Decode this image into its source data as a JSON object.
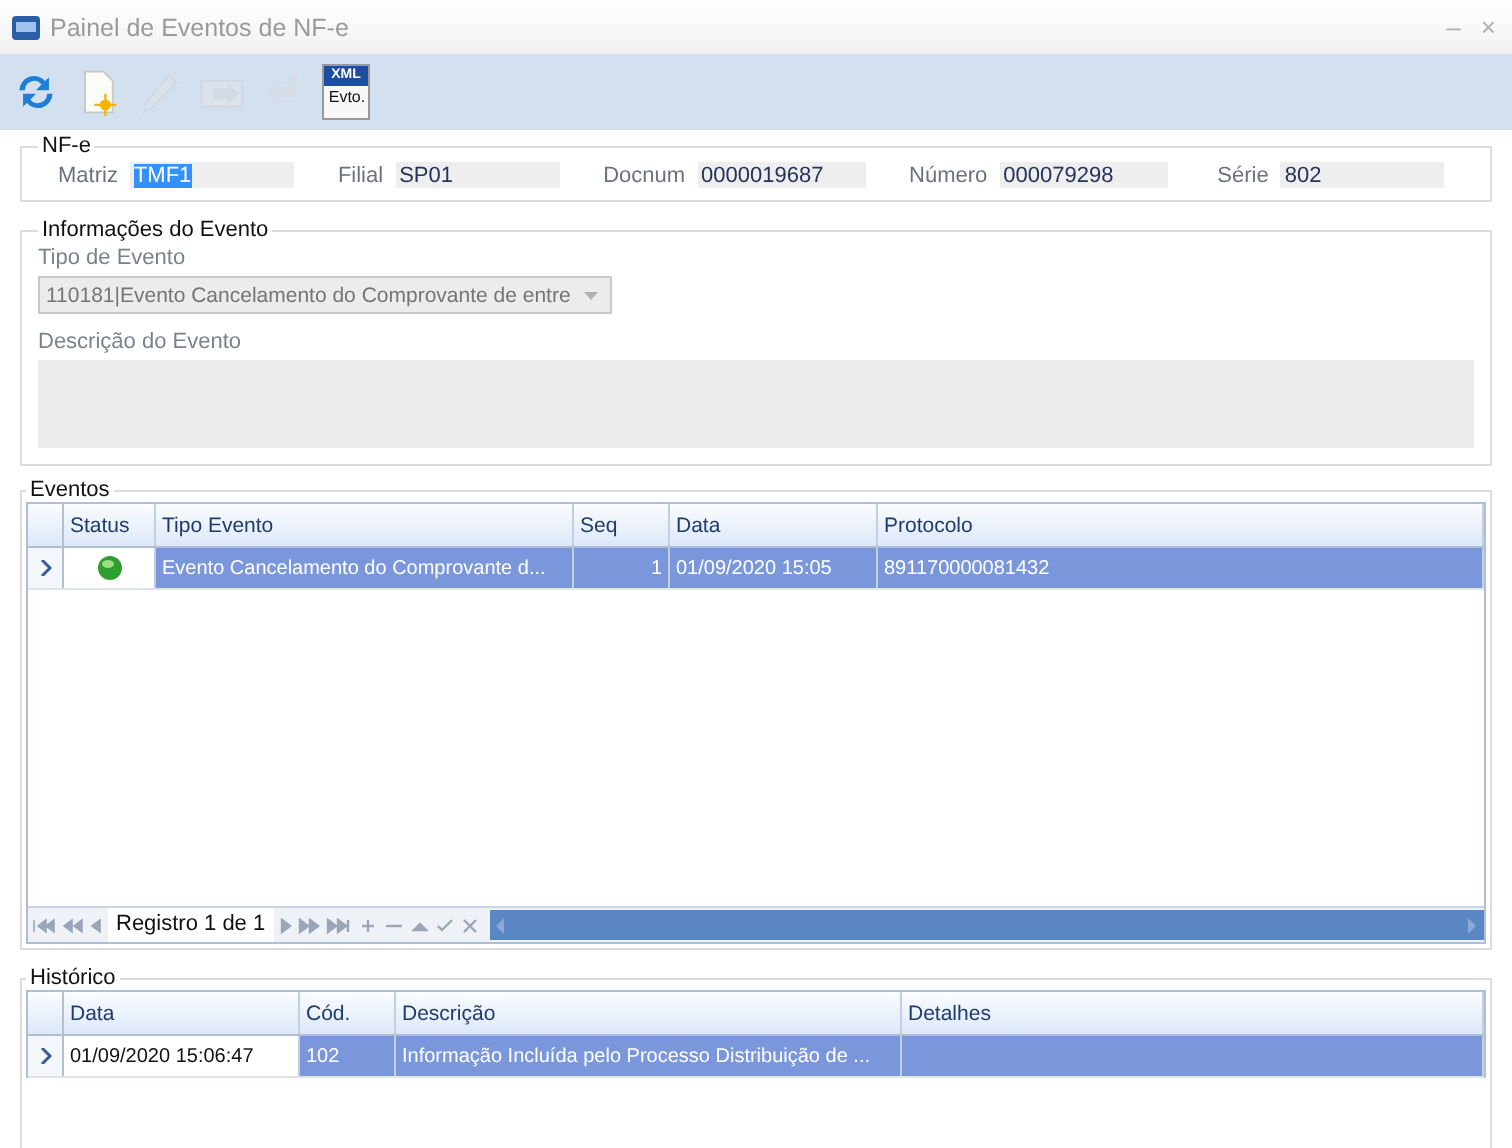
{
  "window": {
    "title": "Painel de Eventos de NF-e",
    "controls": [
      "–",
      "×"
    ]
  },
  "toolbar": [
    {
      "kind": "refresh",
      "disabled": false
    },
    {
      "kind": "new",
      "disabled": false
    },
    {
      "kind": "edit",
      "disabled": true
    },
    {
      "kind": "import",
      "disabled": true
    },
    {
      "kind": "undo",
      "disabled": true
    },
    {
      "kind": "xml",
      "disabled": false,
      "top_text": "XML",
      "bottom_text": "Evto."
    }
  ],
  "nfe": {
    "title": "NF-e",
    "fields": [
      {
        "label": "Matriz",
        "value": "TMF1",
        "text_selected": true
      },
      {
        "label": "Filial",
        "value": "SP01",
        "text_selected": false
      },
      {
        "label": "Docnum",
        "value": "0000019687",
        "text_selected": false
      },
      {
        "label": "Número",
        "value": "000079298",
        "text_selected": false
      },
      {
        "label": "Série",
        "value": "802",
        "text_selected": false
      }
    ]
  },
  "info": {
    "title": "Informações do Evento",
    "tipo_label": "Tipo de Evento",
    "tipo_value": "110181|Evento Cancelamento do Comprovante de entre",
    "descricao_label": "Descrição do Evento"
  },
  "eventos": {
    "title": "Eventos",
    "columns": [
      "Status",
      "Tipo Evento",
      "Seq",
      "Data",
      "Protocolo"
    ],
    "rows": [
      {
        "selected": true,
        "cells": [
          {
            "kind": "status",
            "color": "#2e9e2e",
            "focused": true
          },
          {
            "kind": "text",
            "text": "Evento Cancelamento do Comprovante d...",
            "focused": false
          },
          {
            "kind": "number",
            "text": "1",
            "focused": false
          },
          {
            "kind": "text",
            "text": "01/09/2020 15:05",
            "focused": false
          },
          {
            "kind": "text",
            "text": "891170000081432",
            "focused": false
          }
        ]
      }
    ],
    "navigator": {
      "record_text": "Registro 1 de 1"
    }
  },
  "historico": {
    "title": "Histórico",
    "columns": [
      "Data",
      "Cód.",
      "Descrição",
      "Detalhes"
    ],
    "rows": [
      {
        "selected": true,
        "cells": [
          {
            "kind": "text",
            "text": "01/09/2020 15:06:47",
            "focused": true
          },
          {
            "kind": "text",
            "text": "102",
            "focused": false
          },
          {
            "kind": "text",
            "text": "Informação Incluída pelo Processo Distribuição de ...",
            "focused": false
          },
          {
            "kind": "text",
            "focused": false
          }
        ]
      }
    ]
  }
}
